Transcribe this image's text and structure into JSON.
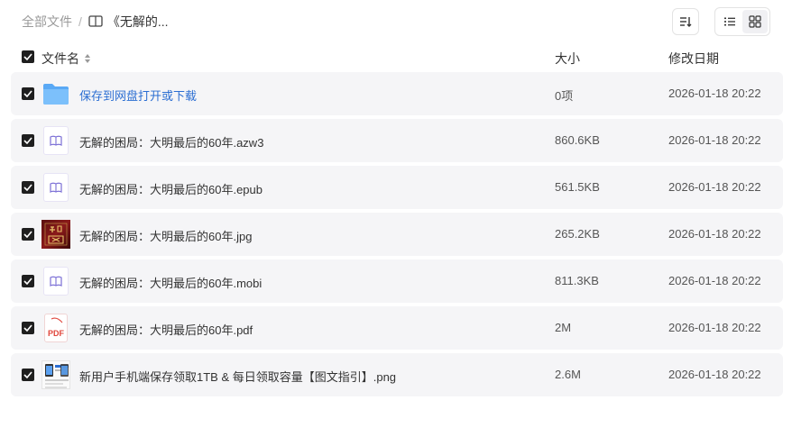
{
  "breadcrumb": {
    "root": "全部文件",
    "separator": "/",
    "current": "《无解的..."
  },
  "toolbar": {
    "sort_icon": "sort-descending-icon",
    "view_list_icon": "list-view-icon",
    "view_grid_icon": "grid-view-icon",
    "active_view": "list"
  },
  "columns": {
    "name": "文件名",
    "size": "大小",
    "modified": "修改日期"
  },
  "files": [
    {
      "name": "保存到网盘打开或下载",
      "size": "0项",
      "date": "2026-01-18 20:22",
      "type": "folder"
    },
    {
      "name": "无解的困局：大明最后的60年.azw3",
      "size": "860.6KB",
      "date": "2026-01-18 20:22",
      "type": "ebook"
    },
    {
      "name": "无解的困局：大明最后的60年.epub",
      "size": "561.5KB",
      "date": "2026-01-18 20:22",
      "type": "ebook"
    },
    {
      "name": "无解的困局：大明最后的60年.jpg",
      "size": "265.2KB",
      "date": "2026-01-18 20:22",
      "type": "image"
    },
    {
      "name": "无解的困局：大明最后的60年.mobi",
      "size": "811.3KB",
      "date": "2026-01-18 20:22",
      "type": "ebook"
    },
    {
      "name": "无解的困局：大明最后的60年.pdf",
      "size": "2M",
      "date": "2026-01-18 20:22",
      "type": "pdf"
    },
    {
      "name": "新用户手机端保存领取1TB & 每日领取容量【图文指引】.png",
      "size": "2.6M",
      "date": "2026-01-18 20:22",
      "type": "png"
    }
  ],
  "thumbs": {
    "pdf_label": "PDF",
    "jpg_cover_chars": "解困局"
  },
  "colors": {
    "folder_link": "#2b6ed2",
    "row_bg": "#f5f5f7",
    "checkbox": "#1f1f1f",
    "ebook_icon": "#7b6fd6",
    "pdf_red": "#e0453b"
  }
}
